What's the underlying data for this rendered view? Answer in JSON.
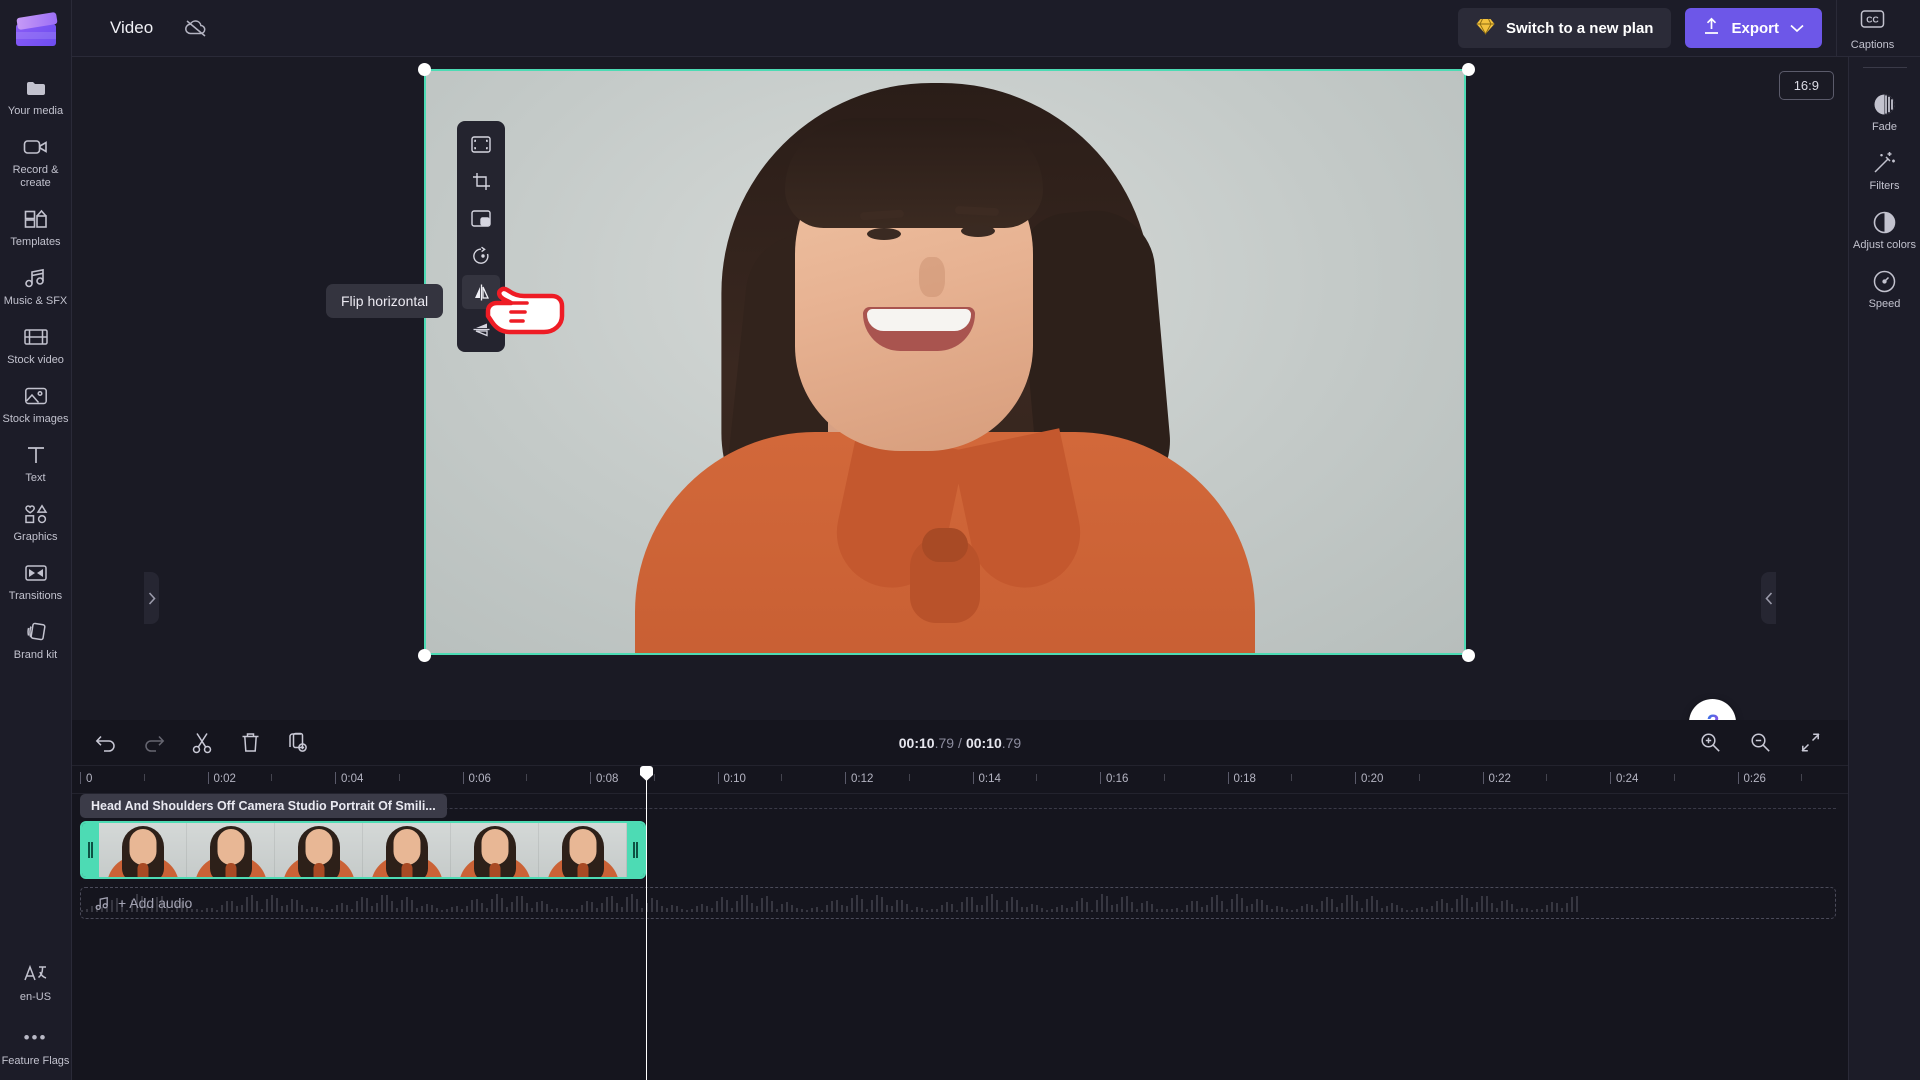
{
  "app": {
    "title": "Video",
    "cloud_status_icon": "cloud-off-icon"
  },
  "topbar": {
    "plan_button": {
      "label": "Switch to a new plan",
      "icon": "diamond-icon",
      "accent": "#f3c23d"
    },
    "export_button": {
      "label": "Export",
      "icon": "upload-icon",
      "chevron": "chevron-down-icon",
      "color": "#6d57e8"
    },
    "captions": {
      "label": "Captions",
      "icon": "cc-icon"
    }
  },
  "left_sidebar": {
    "logo": "clipchamp-logo",
    "items": [
      {
        "label": "Your media",
        "icon": "folder-icon"
      },
      {
        "label": "Record & create",
        "icon": "camera-icon"
      },
      {
        "label": "Templates",
        "icon": "templates-icon"
      },
      {
        "label": "Music & SFX",
        "icon": "music-note-icon"
      },
      {
        "label": "Stock video",
        "icon": "film-strip-icon"
      },
      {
        "label": "Stock images",
        "icon": "image-icon"
      },
      {
        "label": "Text",
        "icon": "text-icon"
      },
      {
        "label": "Graphics",
        "icon": "shapes-icon"
      },
      {
        "label": "Transitions",
        "icon": "transitions-icon"
      },
      {
        "label": "Brand kit",
        "icon": "brand-kit-icon"
      }
    ],
    "bottom_items": [
      {
        "label": "en-US",
        "icon": "language-icon"
      },
      {
        "label": "Feature Flags",
        "icon": "ellipsis-icon"
      }
    ]
  },
  "right_sidebar": {
    "items": [
      {
        "label": "Fade",
        "icon": "fade-icon"
      },
      {
        "label": "Filters",
        "icon": "magic-wand-icon"
      },
      {
        "label": "Adjust colors",
        "icon": "contrast-icon"
      },
      {
        "label": "Speed",
        "icon": "speedometer-icon"
      }
    ]
  },
  "stage": {
    "aspect_ratio_badge": "16:9",
    "collapse_left_icon": "chevron-right-icon",
    "collapse_right_icon": "chevron-left-icon",
    "help_button_icon": "question-mark-icon",
    "help_tab_icon": "chevron-down-icon",
    "selection_color": "#4ddbb4"
  },
  "edit_toolbar": {
    "tooltip": "Flip horizontal",
    "cursor": "pointing-hand-cursor",
    "buttons": [
      {
        "name": "fit-to-frame",
        "icon": "fit-frame-icon"
      },
      {
        "name": "crop",
        "icon": "crop-icon"
      },
      {
        "name": "picture-in-picture",
        "icon": "pip-icon"
      },
      {
        "name": "rotate",
        "icon": "rotate-icon"
      },
      {
        "name": "flip-horizontal",
        "icon": "flip-horizontal-icon",
        "active": true
      },
      {
        "name": "flip-vertical",
        "icon": "flip-vertical-icon"
      }
    ]
  },
  "player": {
    "controls": [
      {
        "name": "skip-to-start",
        "icon": "skip-previous-icon"
      },
      {
        "name": "rewind-5s",
        "icon": "replay-5-icon"
      },
      {
        "name": "play",
        "icon": "play-icon"
      },
      {
        "name": "forward-5s",
        "icon": "forward-5-icon"
      },
      {
        "name": "skip-to-end",
        "icon": "skip-next-icon"
      }
    ],
    "fullscreen_icon": "fullscreen-icon"
  },
  "timeline": {
    "tools": [
      {
        "name": "undo",
        "icon": "undo-icon",
        "enabled": true
      },
      {
        "name": "redo",
        "icon": "redo-icon",
        "enabled": false
      },
      {
        "name": "split",
        "icon": "scissors-icon",
        "enabled": true
      },
      {
        "name": "delete",
        "icon": "trash-icon",
        "enabled": true
      },
      {
        "name": "duplicate",
        "icon": "duplicate-icon",
        "enabled": true
      }
    ],
    "timecode": {
      "current": "00:10",
      "current_frac": ".79",
      "separator": "/",
      "total": "00:10",
      "total_frac": ".79"
    },
    "zoom_tools": [
      {
        "name": "zoom-in",
        "icon": "zoom-in-icon"
      },
      {
        "name": "zoom-out",
        "icon": "zoom-out-icon"
      },
      {
        "name": "fit-timeline",
        "icon": "fit-timeline-icon"
      }
    ],
    "ruler_labels": [
      "0",
      "0:02",
      "0:04",
      "0:06",
      "0:08",
      "0:10",
      "0:12",
      "0:14",
      "0:16",
      "0:18",
      "0:20",
      "0:22",
      "0:24",
      "0:26"
    ],
    "playhead_time": "0:10.79",
    "video_clip": {
      "title": "Head And Shoulders Off Camera Studio Portrait Of Smili...",
      "thumb_count": 6,
      "handle_icon": "trim-handle-grip"
    },
    "audio_track": {
      "label": "+ Add audio",
      "icon": "music-note-icon"
    }
  }
}
